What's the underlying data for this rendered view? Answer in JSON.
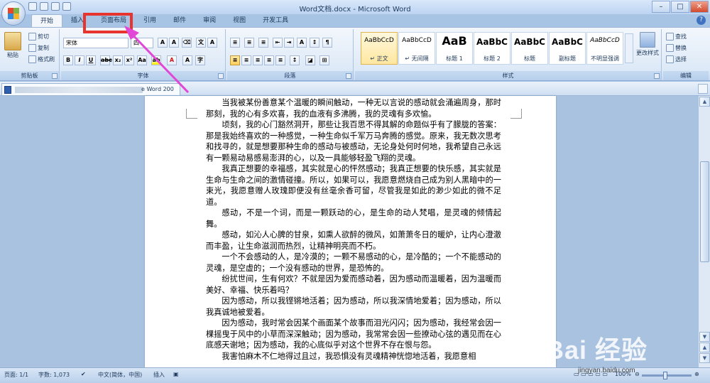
{
  "window": {
    "title": "Word文档.docx - Microsoft Word"
  },
  "tabs": [
    "开始",
    "插入",
    "页面布局",
    "引用",
    "邮件",
    "审阅",
    "视图",
    "开发工具"
  ],
  "ribbon": {
    "clipboard": {
      "paste": "粘贴",
      "cut": "剪切",
      "copy": "复制",
      "format_painter": "格式刷",
      "label": "剪贴板"
    },
    "font": {
      "name": "宋体",
      "size": "四",
      "label": "字体"
    },
    "paragraph": {
      "label": "段落"
    },
    "styles": {
      "label": "样式",
      "items": [
        {
          "preview": "AaBbCcD",
          "name": "↵ 正文"
        },
        {
          "preview": "AaBbCcD",
          "name": "↵ 无间隔"
        },
        {
          "preview": "AaB",
          "name": "标题 1"
        },
        {
          "preview": "AaBbC",
          "name": "标题 2"
        },
        {
          "preview": "AaBbC",
          "name": "标题"
        },
        {
          "preview": "AaBbC",
          "name": "副标题"
        },
        {
          "preview": "AaBbCcD",
          "name": "不明显强调"
        }
      ],
      "change_styles": "更改样式"
    },
    "editing": {
      "find": "查找",
      "replace": "替换",
      "select": "选择",
      "label": "编辑"
    }
  },
  "document_tab": {
    "label": "e Word 200"
  },
  "document": {
    "paragraphs": [
      "当我被某份善意某个温暖的瞬间触动，一种无以言说的感动就会涌遍周身，那时那刻，我的心有多欢喜，我的血液有多沸腾，我的灵魂有多欢愉。",
      "顷刻，我的心门豁然洞开，那些让我百思不得其解的命题似乎有了朦胧的答案：那是我始终喜欢的一种感觉，一种生命似千军万马奔腾的感觉。原来，我无数次思考和找寻的，就是想要那种生命的感动与被感动，无论身处何时何地，我希望自己永远有一颗易动易感易澎湃的心，以及一具能够轻盈飞翔的灵魂。",
      "我真正想要的幸福感，其实就是心的怦然感动；我真正想要的快乐感，其实就是生命与生命之间的激情碰撞。所以，如果可以，我愿意燃烧自己成为别人黑暗中的一束光，我愿意赠人玫瑰即便没有丝毫余香可留，尽管我是如此的渺少如此的微不足道。",
      "感动，不是一个词，而是一颗跃动的心，是生命的动人梵唱，是灵魂的倾情起舞。",
      "感动，如沁人心脾的甘泉，如熏人欲醉的微风，如萧萧冬日的暖炉，让内心澄澈而丰盈，让生命滋润而热烈，让精神明亮而不朽。",
      "一个不会感动的人，是冷漠的；一颗不易感动的心，是冷酷的；一个不能感动的灵魂，是空虚的；一个没有感动的世界，是恐怖的。",
      "纷扰世间，生有何欢？不就是因为爱而感动着，因为感动而温暖着，因为温暖而美好、幸福、快乐着吗？",
      "因为感动，所以我铿锵地活着；因为感动，所以我深情地爱着；因为感动，所以我真诚地被爱着。",
      "因为感动，我时常会因某个画面某个故事而泪光闪闪；因为感动，我经常会因一棵摇曳于风中的小草而深深触动；因为感动，我常常会因一些撩动心弦的遇见而在心底感天谢地；因为感动，我的心底似乎对这个世界不存在恨与怨。",
      "我害怕麻木不仁地得过且过，我恐惧没有灵魂精神恍惚地活着，我愿意相"
    ]
  },
  "status": {
    "page": "页面: 1/1",
    "words": "字数: 1,073",
    "language": "中文(简体，中国)",
    "mode": "插入",
    "zoom": "100%"
  },
  "watermark": {
    "brand": "Bai 经验",
    "url": "jingyan.baidu.com"
  },
  "colors": {
    "annotation": "#e8342e",
    "arrow": "#e246d6"
  }
}
